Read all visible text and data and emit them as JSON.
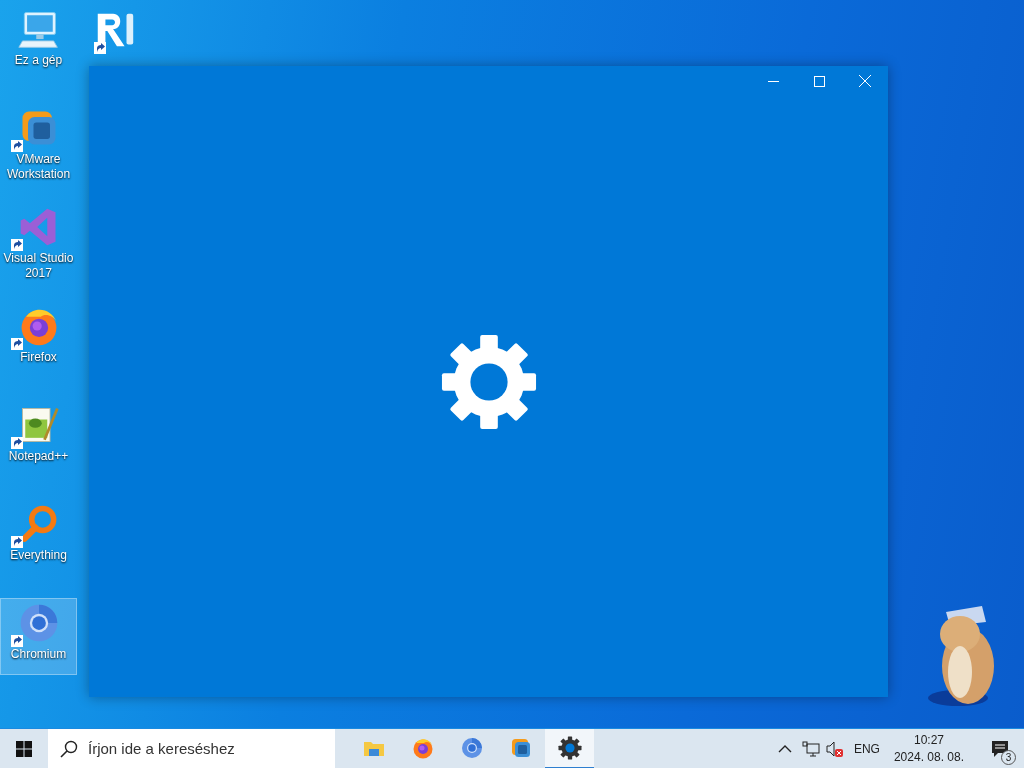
{
  "desktop_icons": [
    {
      "kind": "computer",
      "label": "Ez a gép",
      "shortcut": false,
      "selected": false
    },
    {
      "kind": "vmware",
      "label": "VMware Workstation",
      "shortcut": true,
      "selected": false
    },
    {
      "kind": "visualstudio",
      "label": "Visual Studio 2017",
      "shortcut": true,
      "selected": false
    },
    {
      "kind": "firefox",
      "label": "Firefox",
      "shortcut": true,
      "selected": false
    },
    {
      "kind": "notepad",
      "label": "Notepad++",
      "shortcut": true,
      "selected": false
    },
    {
      "kind": "everything",
      "label": "Everything",
      "shortcut": true,
      "selected": false
    },
    {
      "kind": "chromium",
      "label": "Chromium",
      "shortcut": true,
      "selected": true
    }
  ],
  "desktop_icons_col2": [
    {
      "kind": "vnc",
      "shortcut": true
    }
  ],
  "taskbar": {
    "search": {
      "placeholder": "Írjon ide a kereséshez"
    },
    "apps": [
      {
        "kind": "explorer",
        "selected": false
      },
      {
        "kind": "firefox",
        "selected": false
      },
      {
        "kind": "chromium",
        "selected": false
      },
      {
        "kind": "vmware",
        "selected": false
      },
      {
        "kind": "settings",
        "selected": true
      }
    ],
    "language": "ENG",
    "time": "10:27",
    "date": "2024. 08. 08.",
    "notifications": "3"
  }
}
